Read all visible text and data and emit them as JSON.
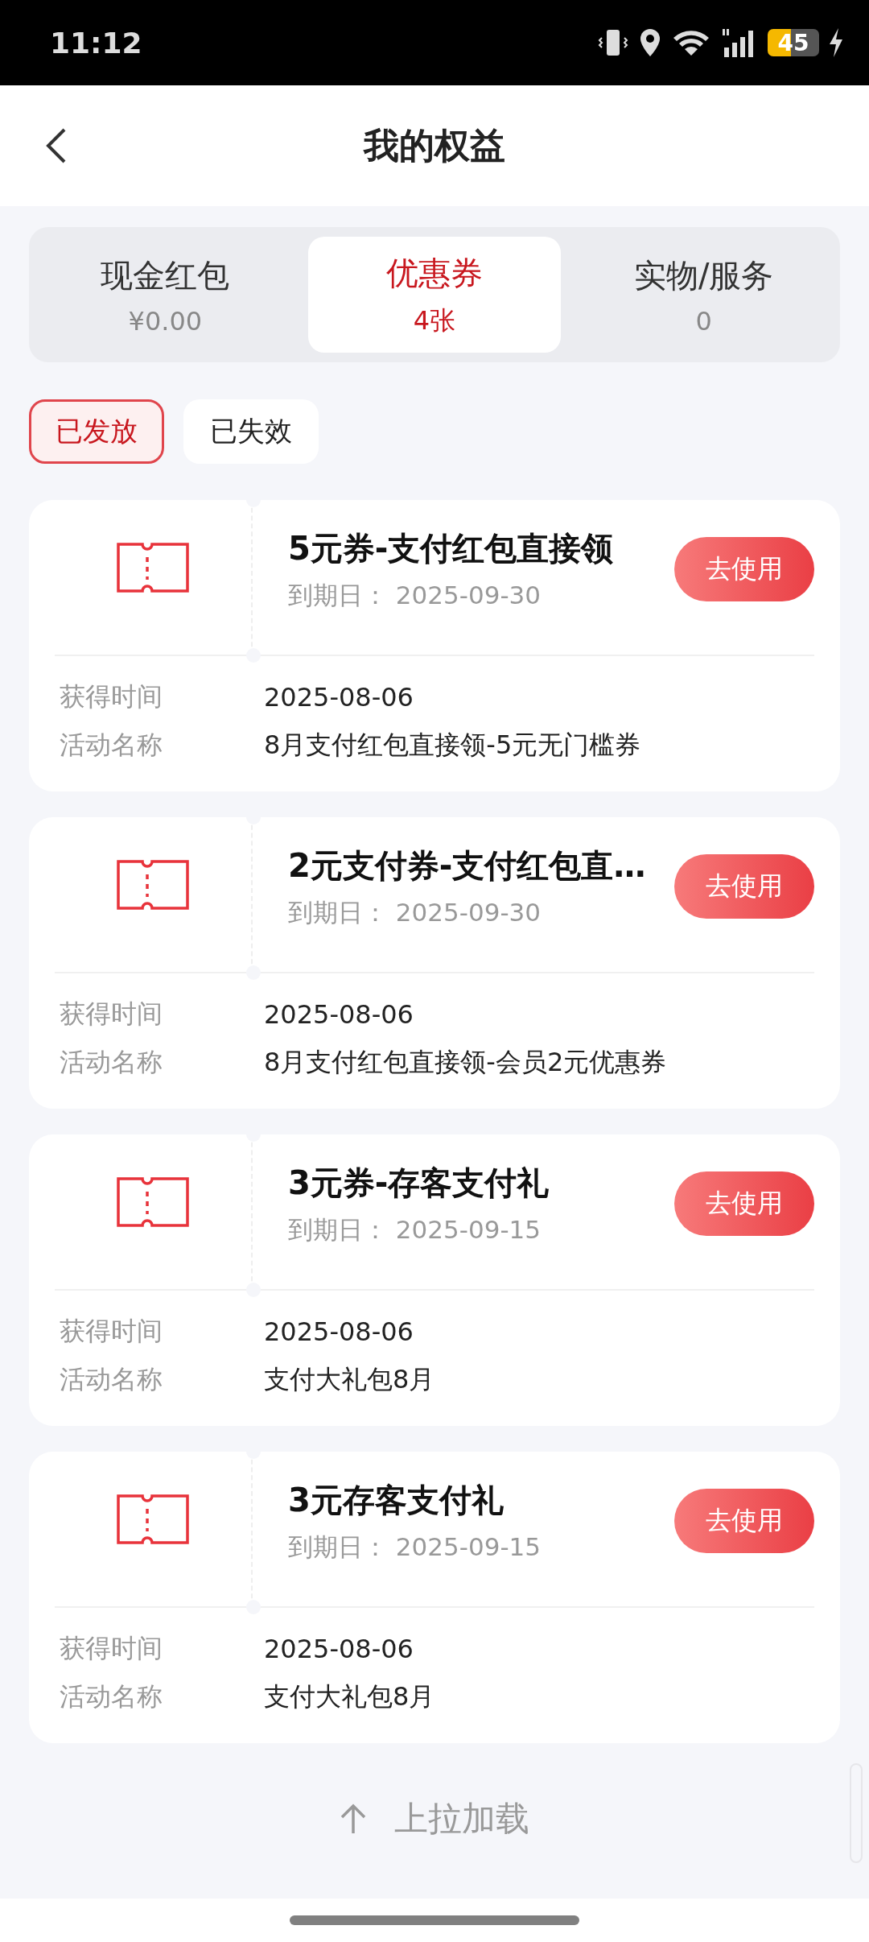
{
  "status_bar": {
    "time": "11:12",
    "battery": "45"
  },
  "header": {
    "title": "我的权益"
  },
  "tabs": [
    {
      "label": "现金红包",
      "value": "¥0.00",
      "selected": false
    },
    {
      "label": "优惠券",
      "value": "4张",
      "selected": true
    },
    {
      "label": "实物/服务",
      "value": "0",
      "selected": false
    }
  ],
  "filters": [
    {
      "label": "已发放",
      "selected": true
    },
    {
      "label": "已失效",
      "selected": false
    }
  ],
  "coupons": [
    {
      "title": "5元券-支付红包直接领",
      "expiry_label": "到期日：",
      "expiry": "2025-09-30",
      "button": "去使用",
      "rows": [
        {
          "label": "获得时间",
          "value": "2025-08-06"
        },
        {
          "label": "活动名称",
          "value": "8月支付红包直接领-5元无门槛券"
        }
      ]
    },
    {
      "title": "2元支付券-支付红包直…",
      "expiry_label": "到期日：",
      "expiry": "2025-09-30",
      "button": "去使用",
      "rows": [
        {
          "label": "获得时间",
          "value": "2025-08-06"
        },
        {
          "label": "活动名称",
          "value": "8月支付红包直接领-会员2元优惠券"
        }
      ]
    },
    {
      "title": "3元券-存客支付礼",
      "expiry_label": "到期日：",
      "expiry": "2025-09-15",
      "button": "去使用",
      "rows": [
        {
          "label": "获得时间",
          "value": "2025-08-06"
        },
        {
          "label": "活动名称",
          "value": "支付大礼包8月"
        }
      ]
    },
    {
      "title": "3元存客支付礼",
      "expiry_label": "到期日：",
      "expiry": "2025-09-15",
      "button": "去使用",
      "rows": [
        {
          "label": "获得时间",
          "value": "2025-08-06"
        },
        {
          "label": "活动名称",
          "value": "支付大礼包8月"
        }
      ]
    }
  ],
  "footer": {
    "text": "上拉加载"
  }
}
